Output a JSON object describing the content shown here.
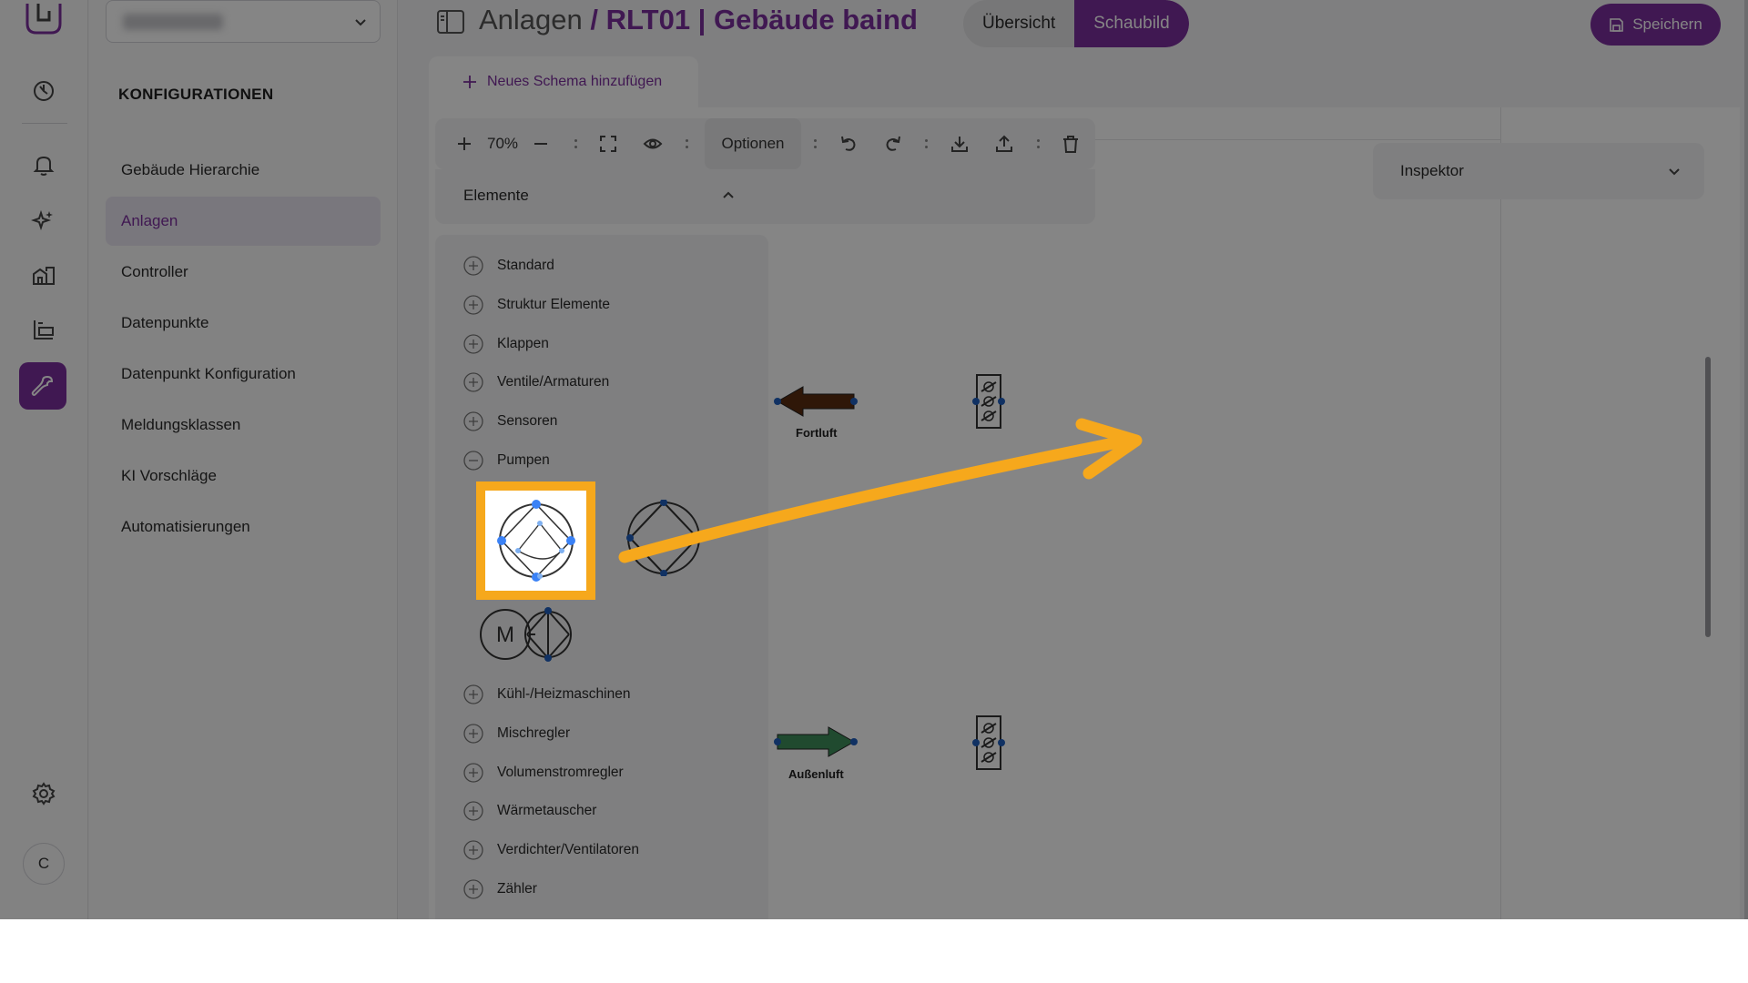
{
  "header": {
    "breadcrumb_parent": "Anlagen",
    "breadcrumb_sep": " / ",
    "breadcrumb_current": "RLT01 | Gebäude baind",
    "view_toggle": [
      "Übersicht",
      "Schaubild"
    ],
    "active_view": "Schaubild",
    "save_label": "Speichern"
  },
  "sidebar": {
    "heading": "KONFIGURATIONEN",
    "items": [
      {
        "label": "Gebäude Hierarchie",
        "active": false
      },
      {
        "label": "Anlagen",
        "active": true
      },
      {
        "label": "Controller",
        "active": false
      },
      {
        "label": "Datenpunkte",
        "active": false
      },
      {
        "label": "Datenpunkt Konfiguration",
        "active": false
      },
      {
        "label": "Meldungsklassen",
        "active": false
      },
      {
        "label": "KI Vorschläge",
        "active": false
      },
      {
        "label": "Automatisierungen",
        "active": false
      }
    ]
  },
  "rail": {
    "icons": [
      "logo-icon",
      "dashboard-icon",
      "bell-icon",
      "sparkles-icon",
      "buildings-icon",
      "devices-icon",
      "wrench-icon",
      "gear-icon"
    ],
    "active_icon": "wrench-icon",
    "avatar_initial": "C"
  },
  "schema_tab": {
    "label": "Neues Schema hinzufügen"
  },
  "toolbar": {
    "zoom": "70%",
    "options_label": "Optionen"
  },
  "elements": {
    "title": "Elemente",
    "categories": [
      {
        "label": "Standard",
        "expanded": false
      },
      {
        "label": "Struktur Elemente",
        "expanded": false
      },
      {
        "label": "Klappen",
        "expanded": false
      },
      {
        "label": "Ventile/Armaturen",
        "expanded": false
      },
      {
        "label": "Sensoren",
        "expanded": false
      },
      {
        "label": "Pumpen",
        "expanded": true
      },
      {
        "label": "Kühl-/Heizmaschinen",
        "expanded": false
      },
      {
        "label": "Mischregler",
        "expanded": false
      },
      {
        "label": "Volumenstromregler",
        "expanded": false
      },
      {
        "label": "Wärmetauscher",
        "expanded": false
      },
      {
        "label": "Verdichter/Ventilatoren",
        "expanded": false
      },
      {
        "label": "Zähler",
        "expanded": false
      }
    ],
    "motor_label": "M"
  },
  "inspector": {
    "title": "Inspektor"
  },
  "canvas": {
    "labels": {
      "exhaust": "Fortluft",
      "outdoor": "Außenluft"
    }
  },
  "colors": {
    "accent": "#7c2f9e",
    "highlight": "#f6a81c",
    "exhaust_arrow": "#5a2c10",
    "outdoor_arrow": "#3f8f5a",
    "connector": "#1f5fbf"
  }
}
